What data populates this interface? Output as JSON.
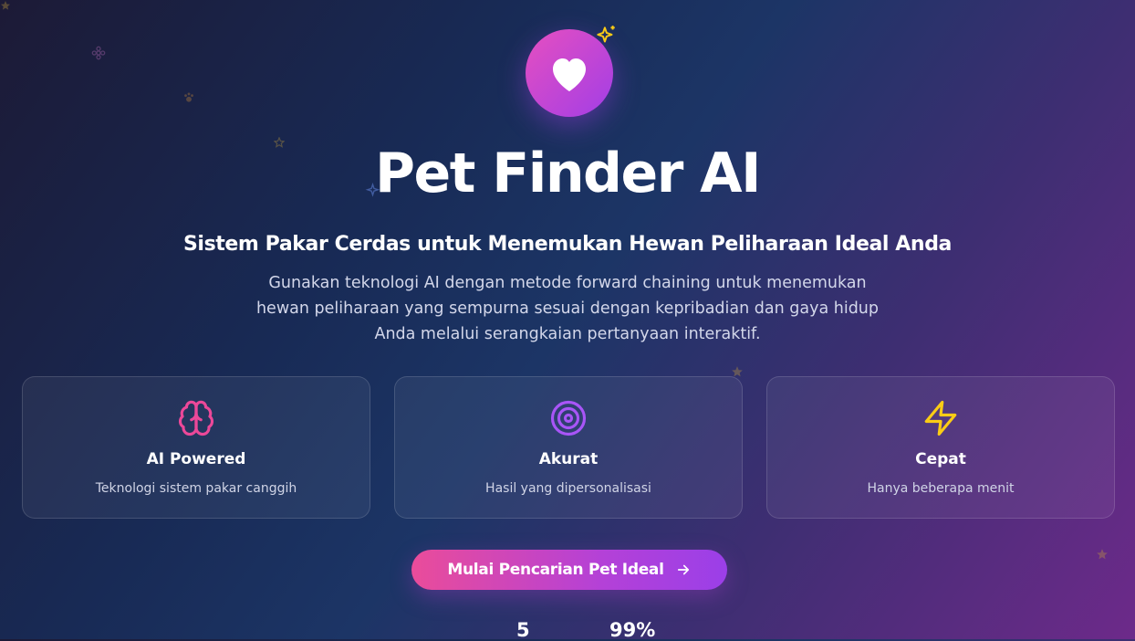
{
  "hero": {
    "title": "Pet Finder AI",
    "subtitle": "Sistem Pakar Cerdas untuk Menemukan Hewan Peliharaan Ideal Anda",
    "description_lines": [
      "Gunakan teknologi AI dengan metode forward chaining untuk menemukan",
      "hewan peliharaan yang sempurna sesuai dengan kepribadian dan gaya hidup",
      "Anda melalui serangkaian pertanyaan interaktif."
    ],
    "icon": "heart-icon",
    "accent_icon": "sparkles-icon"
  },
  "features": [
    {
      "icon": "brain-icon",
      "icon_color": "#ec4899",
      "title": "AI Powered",
      "description": "Teknologi sistem pakar canggih"
    },
    {
      "icon": "target-icon",
      "icon_color": "#a855f7",
      "title": "Akurat",
      "description": "Hasil yang dipersonalisasi"
    },
    {
      "icon": "zap-icon",
      "icon_color": "#facc15",
      "title": "Cepat",
      "description": "Hanya beberapa menit"
    }
  ],
  "cta": {
    "label": "Mulai Pencarian Pet Ideal",
    "icon": "arrow-right-icon"
  },
  "stats": [
    {
      "value": "5"
    },
    {
      "value": "99%"
    }
  ],
  "colors": {
    "accent_pink": "#ec4899",
    "accent_purple": "#9333ea",
    "sparkle_yellow": "#facc15",
    "background_dark": "#1c1a36",
    "background_purple": "#6d2a8a"
  }
}
